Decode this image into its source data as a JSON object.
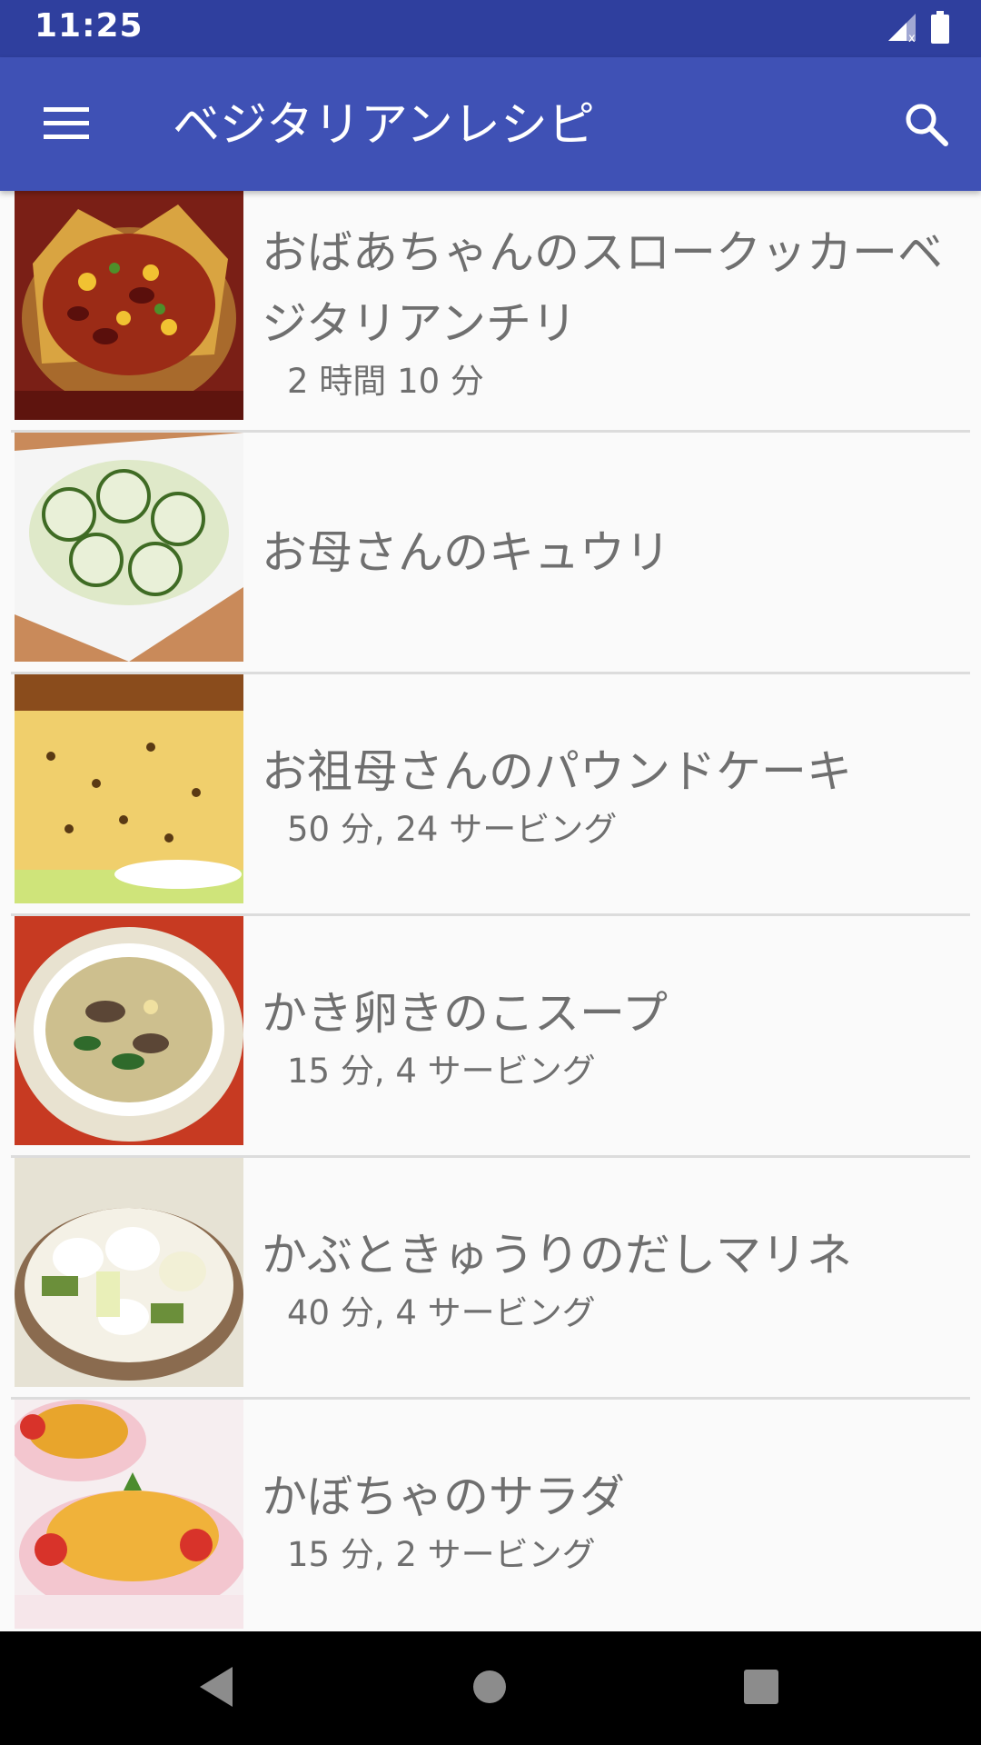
{
  "status_bar": {
    "time": "11:25",
    "icons": [
      "signal-icon",
      "battery-icon"
    ]
  },
  "app_bar": {
    "title": "ベジタリアンレシピ",
    "menu_icon": "menu-icon",
    "search_icon": "search-icon"
  },
  "recipes": [
    {
      "title": "おばあちゃんのスロークッカーベジタリアンチリ",
      "meta": "2 時間 10 分",
      "thumb": "chili-bowl"
    },
    {
      "title": "お母さんのキュウリ",
      "meta": "",
      "thumb": "cucumber-salad"
    },
    {
      "title": "お祖母さんのパウンドケーキ",
      "meta": "50 分, 24 サービング",
      "thumb": "pound-cake"
    },
    {
      "title": "かき卵きのこスープ",
      "meta": "15 分, 4 サービング",
      "thumb": "mushroom-soup"
    },
    {
      "title": "かぶときゅうりのだしマリネ",
      "meta": "40 分, 4 サービング",
      "thumb": "turnip-marinade"
    },
    {
      "title": "かぼちゃのサラダ",
      "meta": "15 分, 2 サービング",
      "thumb": "pumpkin-salad"
    }
  ],
  "nav_bar": {
    "back_icon": "back-icon",
    "home_icon": "home-icon",
    "recents_icon": "recents-icon"
  },
  "colors": {
    "status_bar": "#2f3f9e",
    "app_bar": "#3f51b5",
    "background": "#fafafa",
    "text": "#6f6f6f"
  }
}
